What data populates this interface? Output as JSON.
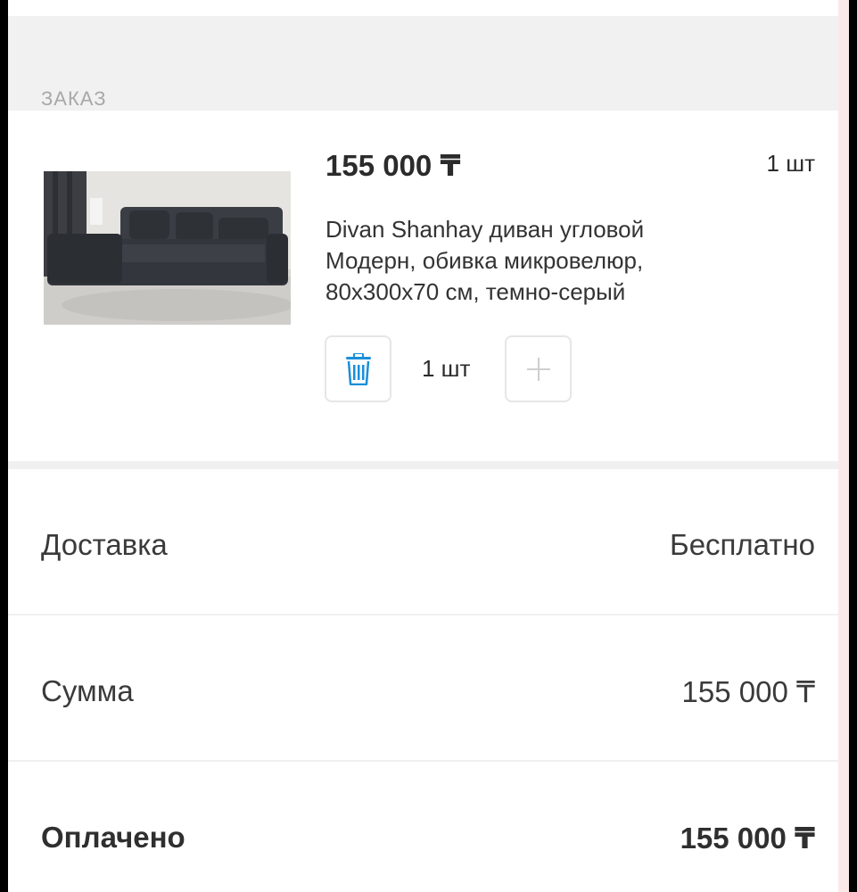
{
  "order": {
    "section_title": "ЗАКАЗ",
    "item": {
      "price": "155 000 ₸",
      "quantity_badge": "1 шт",
      "description": "Divan Shanhay диван угловой Модерн, обивка микровелюр, 80x300x70 см, темно-серый",
      "stepper": {
        "delete_icon": "trash-icon",
        "value": "1 шт",
        "plus_icon": "plus-icon"
      }
    }
  },
  "summary": {
    "delivery": {
      "label": "Доставка",
      "value": "Бесплатно"
    },
    "total": {
      "label": "Сумма",
      "value": "155 000 ₸"
    },
    "paid": {
      "label": "Оплачено",
      "value": "155 000 ₸"
    }
  },
  "colors": {
    "accent": "#1a8fd8",
    "background": "#f1f1f1"
  }
}
